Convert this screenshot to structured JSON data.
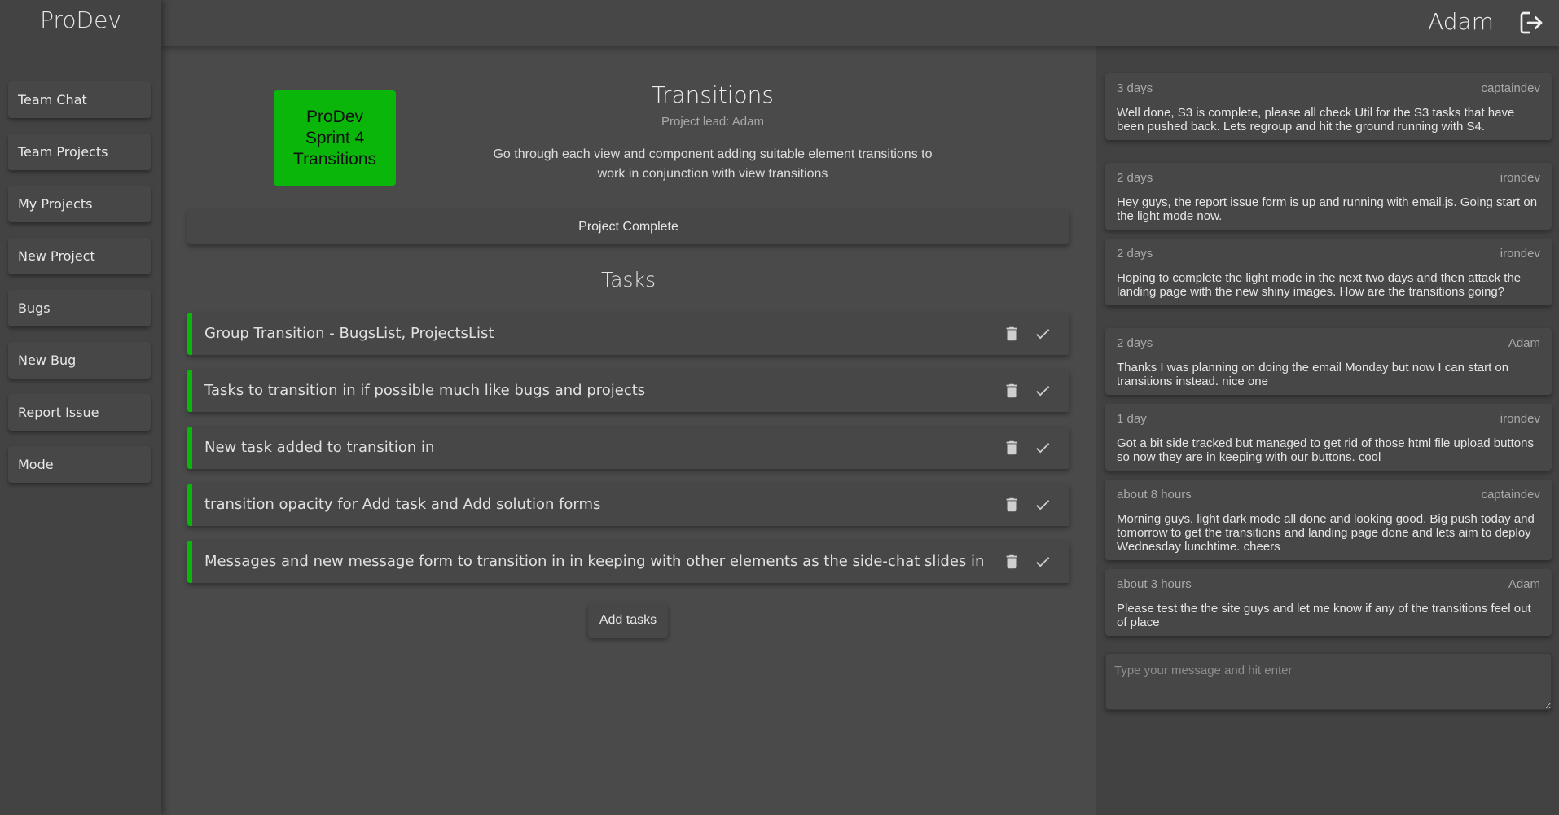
{
  "app": {
    "brand": "ProDev"
  },
  "sidebar": {
    "items": [
      {
        "label": "Team Chat"
      },
      {
        "label": "Team Projects"
      },
      {
        "label": "My Projects"
      },
      {
        "label": "New Project"
      },
      {
        "label": "Bugs"
      },
      {
        "label": "New Bug"
      },
      {
        "label": "Report Issue"
      },
      {
        "label": "Mode"
      }
    ]
  },
  "header": {
    "user_name": "Adam",
    "logout_icon": "logout-icon"
  },
  "project": {
    "thumb_lines": [
      "ProDev",
      "Sprint 4",
      "Transitions"
    ],
    "thumb_color": "#0bb60b",
    "title": "Transitions",
    "lead": "Project lead: Adam",
    "description": "Go through each view and component adding suitable element transitions to work in conjunction with view transitions",
    "complete_label": "Project Complete"
  },
  "tasks": {
    "heading": "Tasks",
    "accent": "#0bb60b",
    "items": [
      {
        "text": "Group Transition - BugsList, ProjectsList"
      },
      {
        "text": "Tasks to transition in if possible much like bugs and projects"
      },
      {
        "text": "New task added to transition in"
      },
      {
        "text": "transition opacity for Add task and Add solution forms"
      },
      {
        "text": "Messages and new message form to transition in in keeping with other elements as the side-chat slides in"
      }
    ],
    "add_label": "Add tasks"
  },
  "chat": {
    "messages": [
      {
        "time": "3 days",
        "author": "captaindev",
        "text": "Well done, S3 is complete, please all check Util for the S3 tasks that have been pushed back. Lets regroup and hit the ground running with S4."
      },
      {
        "time": "2 days",
        "author": "irondev",
        "text": "Hey guys, the report issue form is up and running with email.js. Going start on the light mode now."
      },
      {
        "time": "2 days",
        "author": "irondev",
        "text": "Hoping to complete the light mode in the next two days and then attack the landing page with the new shiny images. How are the transitions going?"
      },
      {
        "time": "2 days",
        "author": "Adam",
        "text": "Thanks I was planning on doing the email Monday but now I can start on transitions instead. nice one"
      },
      {
        "time": "1 day",
        "author": "irondev",
        "text": "Got a bit side tracked but managed to get rid of those html file upload buttons so now they are in keeping with our buttons. cool"
      },
      {
        "time": "about 8 hours",
        "author": "captaindev",
        "text": "Morning guys, light dark mode all done and looking good. Big push today and tomorrow to get the transitions and landing page done and lets aim to deploy Wednesday lunchtime. cheers"
      },
      {
        "time": "about 3 hours",
        "author": "Adam",
        "text": "Please test the the site guys and let me know if any of the transitions feel out of place"
      }
    ],
    "input_placeholder": "Type your message and hit enter"
  }
}
